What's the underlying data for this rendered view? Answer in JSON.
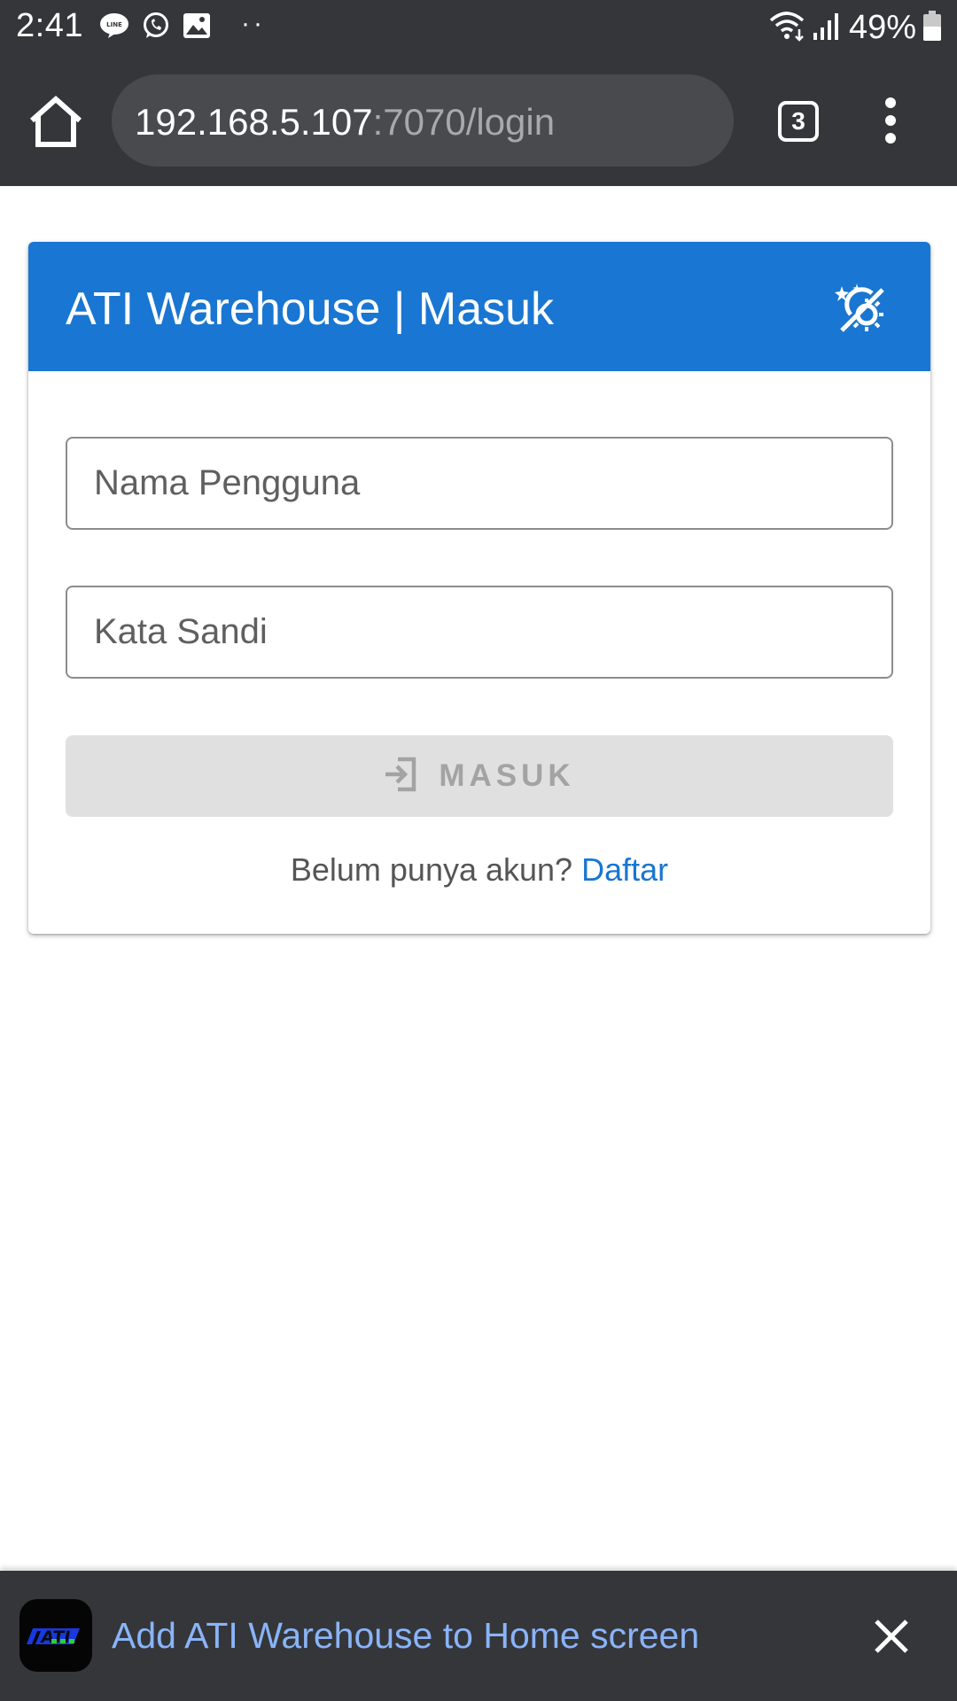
{
  "status_bar": {
    "time": "2:41",
    "notification_icons": [
      "line-app-icon",
      "whatsapp-icon",
      "gallery-icon"
    ],
    "more_notifications": "··",
    "battery_percent": "49%",
    "right_icons": [
      "wifi-icon",
      "signal-icon",
      "battery-icon"
    ]
  },
  "browser": {
    "url_host": "192.168.5.107",
    "url_path": ":7070/login",
    "tab_count": "3",
    "icons": [
      "home-icon",
      "tabs-icon",
      "more-vert-icon"
    ]
  },
  "card": {
    "title": "ATI Warehouse | Masuk",
    "theme_toggle_icon": "theme-toggle-icon",
    "username_label": "Nama Pengguna",
    "password_label": "Kata Sandi",
    "login_button": "MASUK",
    "login_icon": "login-icon",
    "register_prompt": "Belum punya akun?",
    "register_link": "Daftar"
  },
  "install_banner": {
    "logo_text": "ATI",
    "text": "Add ATI Warehouse to Home screen",
    "close_icon": "close-icon"
  },
  "colors": {
    "primary": "#1976d2",
    "chrome_bar": "#35363a",
    "banner_link": "#8ab4f8",
    "disabled_button": "#e0e0e0"
  }
}
